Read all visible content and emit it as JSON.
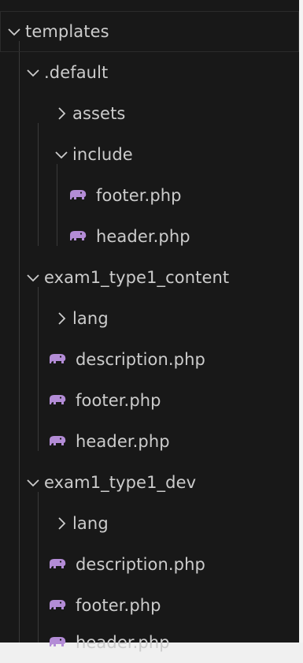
{
  "explorer": {
    "accent_file_icon": "#b38cd6",
    "items": [
      {
        "label": "templates",
        "type": "folder",
        "expanded": true,
        "depth": 0,
        "icon": "chevron-down-icon"
      },
      {
        "label": ".default",
        "type": "folder",
        "expanded": true,
        "depth": 1,
        "icon": "chevron-down-icon"
      },
      {
        "label": "assets",
        "type": "folder",
        "expanded": false,
        "depth": 2,
        "icon": "chevron-right-icon"
      },
      {
        "label": "include",
        "type": "folder",
        "expanded": true,
        "depth": 2,
        "icon": "chevron-down-icon"
      },
      {
        "label": "footer.php",
        "type": "file",
        "depth": 3,
        "icon": "php-elephant-icon"
      },
      {
        "label": "header.php",
        "type": "file",
        "depth": 3,
        "icon": "php-elephant-icon"
      },
      {
        "label": "exam1_type1_content",
        "type": "folder",
        "expanded": true,
        "depth": 1,
        "icon": "chevron-down-icon"
      },
      {
        "label": "lang",
        "type": "folder",
        "expanded": false,
        "depth": 2,
        "icon": "chevron-right-icon"
      },
      {
        "label": "description.php",
        "type": "file",
        "depth": 2,
        "icon": "php-elephant-icon"
      },
      {
        "label": "footer.php",
        "type": "file",
        "depth": 2,
        "icon": "php-elephant-icon"
      },
      {
        "label": "header.php",
        "type": "file",
        "depth": 2,
        "icon": "php-elephant-icon"
      },
      {
        "label": "exam1_type1_dev",
        "type": "folder",
        "expanded": true,
        "depth": 1,
        "icon": "chevron-down-icon"
      },
      {
        "label": "lang",
        "type": "folder",
        "expanded": false,
        "depth": 2,
        "icon": "chevron-right-icon"
      },
      {
        "label": "description.php",
        "type": "file",
        "depth": 2,
        "icon": "php-elephant-icon"
      },
      {
        "label": "footer.php",
        "type": "file",
        "depth": 2,
        "icon": "php-elephant-icon"
      },
      {
        "label": "header.php",
        "type": "file",
        "depth": 2,
        "icon": "php-elephant-icon"
      }
    ]
  }
}
